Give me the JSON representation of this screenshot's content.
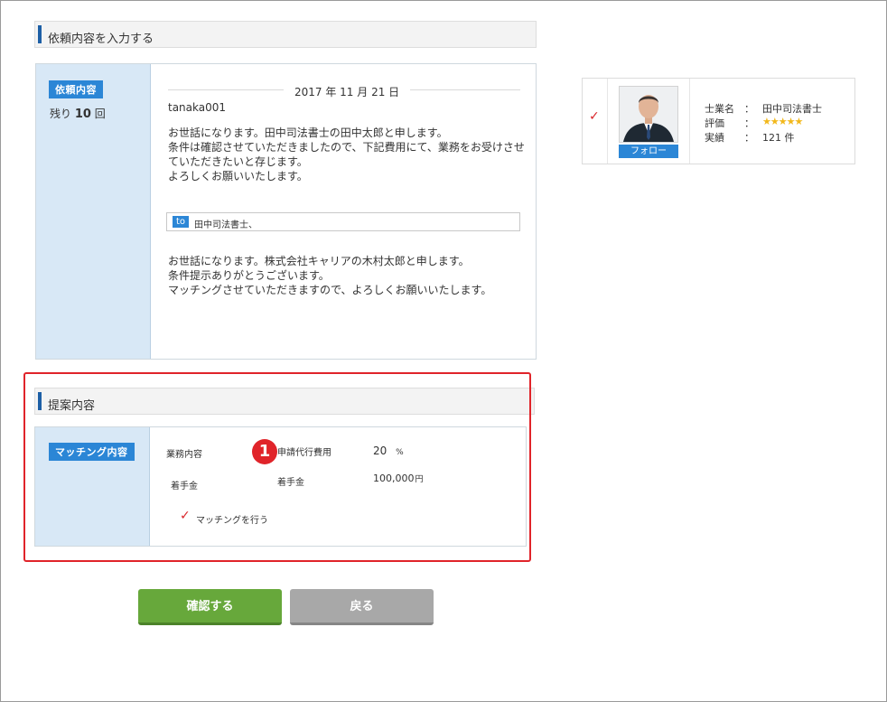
{
  "request_section": {
    "title": "依頼内容を入力する",
    "side_tag": "依頼内容",
    "remaining_prefix": "残り",
    "remaining_count": "10",
    "remaining_suffix": "回",
    "date": "2017 年 11 月 21 日",
    "username": "tanaka001",
    "message_lines": [
      "お世話になります。田中司法書士の田中太郎と申します。",
      "条件は確認させていただきましたので、下記費用にて、業務をお受けさせ",
      "ていただきたいと存じます。",
      "よろしくお願いいたします。"
    ],
    "to_badge": "to",
    "to_text": "田中司法書士、",
    "reply_lines": [
      "お世話になります。株式会社キャリアの木村太郎と申します。",
      "条件提示ありがとうございます。",
      "マッチングさせていただきますので、よろしくお願いいたします。"
    ]
  },
  "proposal_section": {
    "title": "提案内容",
    "side_tag": "マッチング内容",
    "badge_number": "1",
    "field_business": "業務内容",
    "field_fee_label": "申請代行費用",
    "fee_value": "20",
    "fee_unit": "%",
    "field_retainer_left": "着手金",
    "field_retainer_right": "着手金",
    "retainer_value": "100,000",
    "retainer_unit": "円",
    "matching_checkbox_label": "マッチングを行う",
    "matching_checked": true
  },
  "buttons": {
    "confirm": "確認する",
    "back": "戻る"
  },
  "profile_card": {
    "checked": true,
    "follow_label": "フォロー",
    "rows": [
      {
        "key": "士業名",
        "sep": "：",
        "value": "田中司法書士"
      },
      {
        "key": "評価",
        "sep": "：",
        "value": "★★★★★"
      },
      {
        "key": "実績",
        "sep": "：",
        "value": "121 件"
      }
    ]
  },
  "colors": {
    "accent_blue": "#2b86d6",
    "header_bar": "#1d5fa6",
    "highlight_red": "#e0242a",
    "primary_green": "#67a83b",
    "secondary_gray": "#a8a8a8",
    "star_gold": "#f2b81b"
  },
  "icons": {
    "check": "check-icon",
    "number_badge": "number-1-badge-icon",
    "avatar": "person-avatar-icon"
  }
}
